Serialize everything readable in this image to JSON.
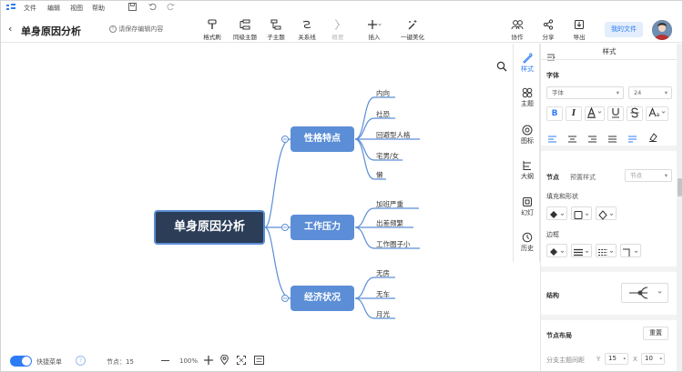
{
  "menu": [
    "文件",
    "编辑",
    "视图",
    "帮助"
  ],
  "doc_title": "单身原因分析",
  "save_hint": "请保存编辑内容",
  "toolbar": [
    {
      "label": "格式刷",
      "disabled": false
    },
    {
      "label": "同级主题",
      "disabled": false
    },
    {
      "label": "子主题",
      "disabled": false
    },
    {
      "label": "关系线",
      "disabled": false
    },
    {
      "label": "概要",
      "disabled": true
    },
    {
      "label": "插入",
      "disabled": false
    },
    {
      "label": "一键美化",
      "disabled": false
    }
  ],
  "right_toolbar": [
    {
      "label": "协作"
    },
    {
      "label": "分享"
    },
    {
      "label": "导出"
    }
  ],
  "my_files": "我的文件",
  "mindmap": {
    "root": "单身原因分析",
    "branches": [
      {
        "label": "性格特点",
        "children": [
          "内向",
          "社恐",
          "回避型人格",
          "宅男/女",
          "懒"
        ]
      },
      {
        "label": "工作压力",
        "children": [
          "加班严重",
          "出差频繁",
          "工作圈子小"
        ]
      },
      {
        "label": "经济状况",
        "children": [
          "无房",
          "无车",
          "月光"
        ]
      }
    ]
  },
  "side_tabs": [
    "样式",
    "主题",
    "图标",
    "大纲",
    "幻灯",
    "历史"
  ],
  "panel": {
    "title": "样式",
    "font_section": "字体",
    "font_family_placeholder": "字体",
    "font_size": "24",
    "node_section": "节点",
    "preset_label": "预置样式",
    "preset_value": "节点",
    "fill_label": "填充和形状",
    "border_label": "边框",
    "structure_label": "结构",
    "layout_label": "节点布局",
    "reset_label": "重置",
    "spacing_label": "分支主题间距",
    "y_label": "Y",
    "y_value": "15",
    "x_label": "X",
    "x_value": "10"
  },
  "status": {
    "quick_menu": "快捷菜单",
    "nodes_label": "节点：",
    "nodes_count": "15",
    "zoom": "100%"
  },
  "colors": {
    "accent": "#2d7cf6",
    "root_bg": "#2b3d57",
    "branch_bg": "#5b8ed6",
    "line": "#5b8ed6"
  }
}
